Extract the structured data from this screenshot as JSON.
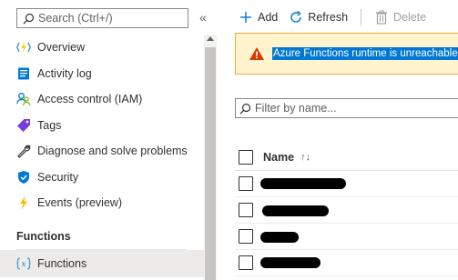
{
  "nav": {
    "search_placeholder": "Search (Ctrl+/)",
    "collapse_glyph": "«",
    "items": [
      {
        "label": "Overview",
        "icon": "function-bolt-icon"
      },
      {
        "label": "Activity log",
        "icon": "activity-log-icon"
      },
      {
        "label": "Access control (IAM)",
        "icon": "people-icon"
      },
      {
        "label": "Tags",
        "icon": "tag-icon"
      },
      {
        "label": "Diagnose and solve problems",
        "icon": "wrench-icon"
      },
      {
        "label": "Security",
        "icon": "shield-icon"
      },
      {
        "label": "Events (preview)",
        "icon": "lightning-icon"
      }
    ],
    "section_heading": "Functions",
    "selected_item": {
      "label": "Functions",
      "icon": "function-icon"
    }
  },
  "toolbar": {
    "add_label": "Add",
    "refresh_label": "Refresh",
    "delete_label": "Delete"
  },
  "alert": {
    "message": "Azure Functions runtime is unreachable",
    "icon": "warning-icon"
  },
  "filter": {
    "placeholder": "Filter by name..."
  },
  "table": {
    "columns": [
      {
        "label": "Name",
        "sort_glyph": "↑↓"
      }
    ],
    "rows": [
      {
        "name": "[redacted]"
      },
      {
        "name": "[redacted]"
      },
      {
        "name": "[redacted]"
      },
      {
        "name": "[redacted]"
      }
    ]
  },
  "colors": {
    "accent": "#0078d4",
    "warning_bg": "#fff4ce",
    "warning_icon": "#d83b01",
    "selected_bg": "#edebe9"
  }
}
